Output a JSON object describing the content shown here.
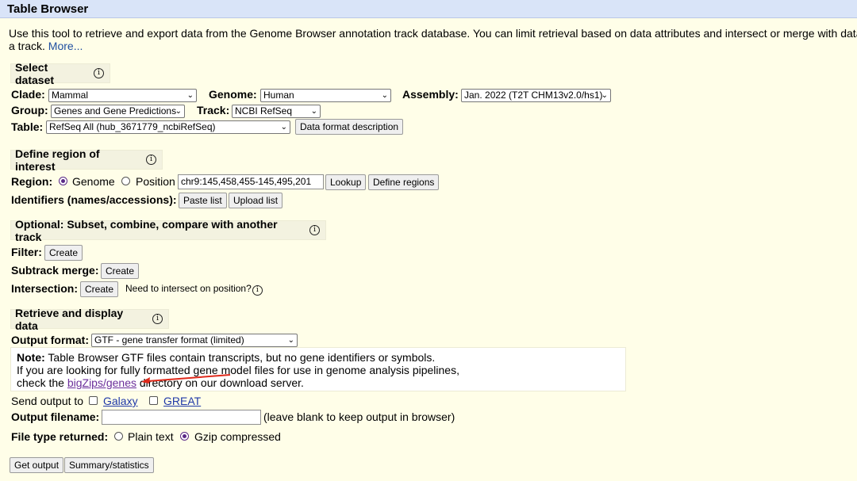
{
  "page": {
    "title": "Table Browser",
    "intro_line1": "Use this tool to retrieve and export data from the Genome Browser annotation track database. You can limit retrieval based on data attributes and intersect or merge with data",
    "intro_line2": "a track. ",
    "intro_more": "More..."
  },
  "dataset": {
    "heading": "Select dataset",
    "clade_label": "Clade:",
    "clade_value": "Mammal",
    "genome_label": "Genome:",
    "genome_value": "Human",
    "assembly_label": "Assembly:",
    "assembly_value": "Jan. 2022 (T2T CHM13v2.0/hs1)",
    "group_label": "Group:",
    "group_value": "Genes and Gene Predictions",
    "track_label": "Track:",
    "track_value": "NCBI RefSeq",
    "table_label": "Table:",
    "table_value": "RefSeq All (hub_3671779_ncbiRefSeq)",
    "format_desc_button": "Data format description"
  },
  "region": {
    "heading": "Define region of interest",
    "region_label": "Region:",
    "genome_option": "Genome",
    "position_option": "Position",
    "position_value": "chr9:145,458,455-145,495,201",
    "lookup_button": "Lookup",
    "define_regions_button": "Define regions",
    "identifiers_label": "Identifiers (names/accessions):",
    "paste_list_button": "Paste list",
    "upload_list_button": "Upload list"
  },
  "optional": {
    "heading": "Optional: Subset, combine, compare with another track",
    "filter_label": "Filter:",
    "filter_button": "Create",
    "subtrack_label": "Subtrack merge:",
    "subtrack_button": "Create",
    "intersection_label": "Intersection:",
    "intersection_button": "Create",
    "intersection_hint": "Need to intersect on position?"
  },
  "retrieve": {
    "heading": "Retrieve and display data",
    "output_format_label": "Output format:",
    "output_format_value": "GTF - gene transfer format (limited)",
    "note_bold": "Note:",
    "note_line1": " Table Browser GTF files contain transcripts, but no gene identifiers or symbols.",
    "note_line2": "If you are looking for fully formatted gene model files for use in genome analysis pipelines,",
    "note_line3_pre": "check the ",
    "note_link": "bigZips/genes",
    "note_line3_post": " directory on our download server.",
    "send_output_label": "Send output to",
    "galaxy_link": "Galaxy",
    "great_link": "GREAT",
    "filename_label": "Output filename:",
    "filename_value": "",
    "filename_hint": "(leave blank to keep output in browser)",
    "filetype_label": "File type returned:",
    "plain_text_option": "Plain text",
    "gzip_option": "Gzip compressed",
    "get_output_button": "Get output",
    "summary_button": "Summary/statistics"
  },
  "icons": {
    "info": "info-circle-icon",
    "dropdown": "chevron-down-icon",
    "annotation_arrow": "red-arrow-annotation"
  },
  "colors": {
    "page_bg": "#fffee8",
    "titlebar_bg": "#d9e4f8",
    "section_bg": "#f3f2e0",
    "link": "#1f38a8",
    "radio_selected": "#5b2a86",
    "annotation_arrow": "#e02a1c"
  }
}
